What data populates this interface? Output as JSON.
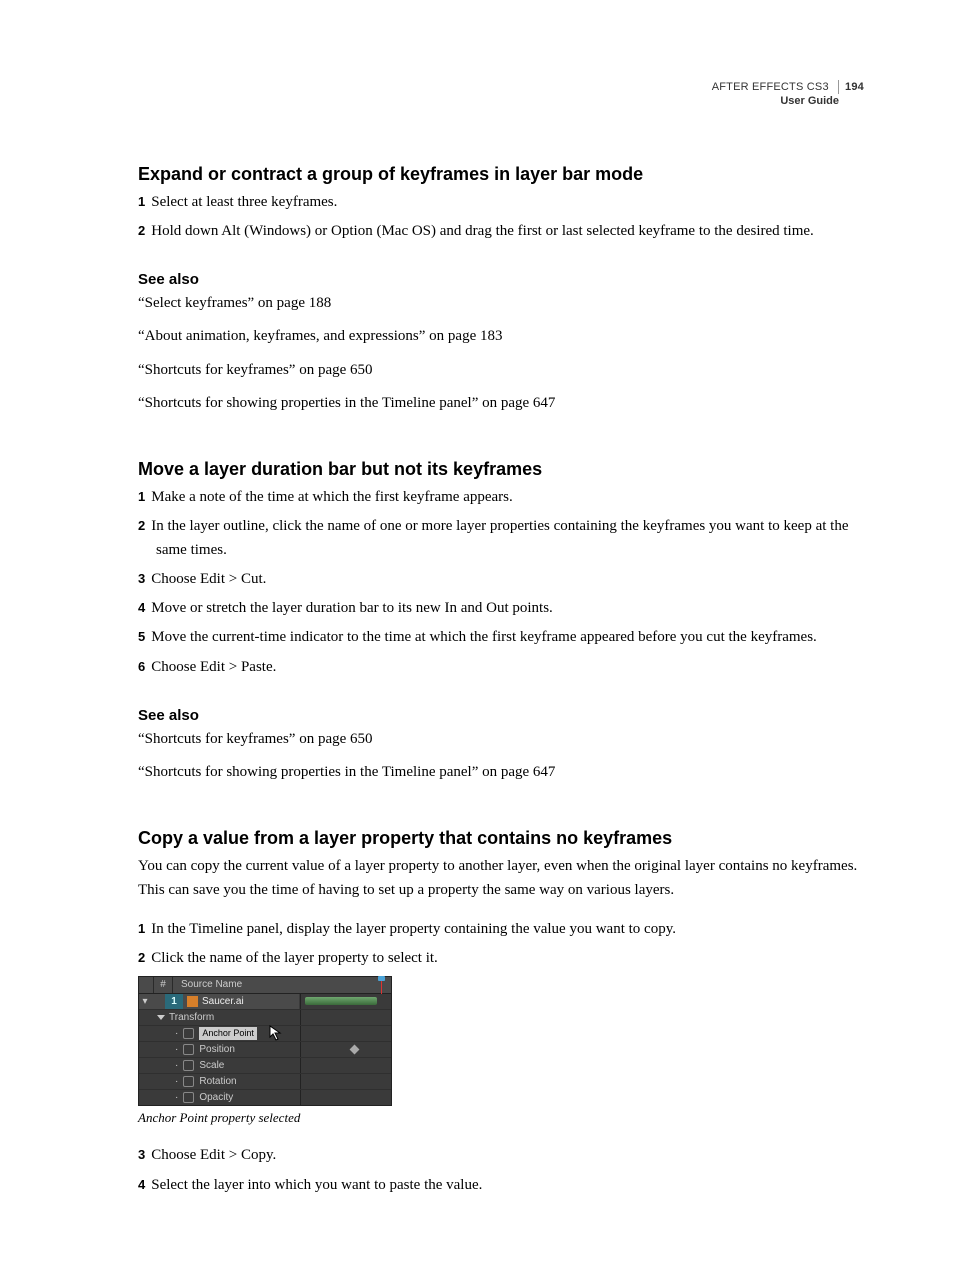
{
  "header": {
    "product": "AFTER EFFECTS CS3",
    "subtitle": "User Guide",
    "page": "194"
  },
  "section1": {
    "title": "Expand or contract a group of keyframes in layer bar mode",
    "steps": [
      "Select at least three keyframes.",
      "Hold down Alt (Windows) or Option (Mac OS) and drag the first or last selected keyframe to the desired time."
    ],
    "seealso_title": "See also",
    "seealso": [
      "“Select keyframes” on page 188",
      "“About animation, keyframes, and expressions” on page 183",
      "“Shortcuts for keyframes” on page 650",
      "“Shortcuts for showing properties in the Timeline panel” on page 647"
    ]
  },
  "section2": {
    "title": "Move a layer duration bar but not its keyframes",
    "steps": [
      "Make a note of the time at which the first keyframe appears.",
      "In the layer outline, click the name of one or more layer properties containing the keyframes you want to keep at the same times.",
      "Choose Edit > Cut.",
      "Move or stretch the layer duration bar to its new In and Out points.",
      "Move the current-time indicator to the time at which the first keyframe appeared before you cut the keyframes.",
      "Choose Edit > Paste."
    ],
    "seealso_title": "See also",
    "seealso": [
      "“Shortcuts for keyframes” on page 650",
      "“Shortcuts for showing properties in the Timeline panel” on page 647"
    ]
  },
  "section3": {
    "title": "Copy a value from a layer property that contains no keyframes",
    "intro": "You can copy the current value of a layer property to another layer, even when the original layer contains no keyframes. This can save you the time of having to set up a property the same way on various layers.",
    "steps_before_figure": [
      "In the Timeline panel, display the layer property containing the value you want to copy.",
      "Click the name of the layer property to select it."
    ],
    "figure": {
      "col_hash": "#",
      "col_name": "Source Name",
      "layer_num": "1",
      "layer_name": "Saucer.ai",
      "transform": "Transform",
      "props": [
        "Anchor Point",
        "Position",
        "Scale",
        "Rotation",
        "Opacity"
      ],
      "caption": "Anchor Point property selected"
    },
    "steps_after_figure": [
      "Choose Edit > Copy.",
      "Select the layer into which you want to paste the value."
    ]
  }
}
